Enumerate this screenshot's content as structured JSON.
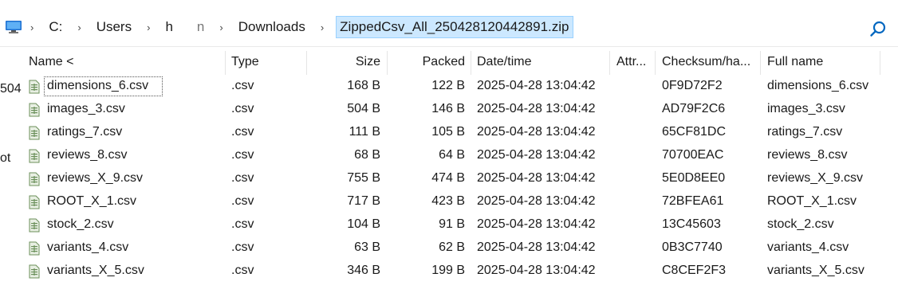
{
  "address_bar": {
    "crumbs": [
      "C:",
      "Users",
      "h",
      "n",
      "Downloads",
      "ZippedCsv_All_250428120442891.zip"
    ],
    "separator": "›"
  },
  "nav_fragments": [
    "504",
    "ot"
  ],
  "columns": [
    "Name <",
    "Type",
    "Size",
    "Packed",
    "Date/time",
    "Attr...",
    "Checksum/ha...",
    "Full name"
  ],
  "rows": [
    {
      "name": "dimensions_6.csv",
      "type": ".csv",
      "size": "168 B",
      "packed": "122 B",
      "date": "2025-04-28 13:04:42",
      "attr": "",
      "checksum": "0F9D72F2",
      "fullname": "dimensions_6.csv"
    },
    {
      "name": "images_3.csv",
      "type": ".csv",
      "size": "504 B",
      "packed": "146 B",
      "date": "2025-04-28 13:04:42",
      "attr": "",
      "checksum": "AD79F2C6",
      "fullname": "images_3.csv"
    },
    {
      "name": "ratings_7.csv",
      "type": ".csv",
      "size": "111 B",
      "packed": "105 B",
      "date": "2025-04-28 13:04:42",
      "attr": "",
      "checksum": "65CF81DC",
      "fullname": "ratings_7.csv"
    },
    {
      "name": "reviews_8.csv",
      "type": ".csv",
      "size": "68 B",
      "packed": "64 B",
      "date": "2025-04-28 13:04:42",
      "attr": "",
      "checksum": "70700EAC",
      "fullname": "reviews_8.csv"
    },
    {
      "name": "reviews_X_9.csv",
      "type": ".csv",
      "size": "755 B",
      "packed": "474 B",
      "date": "2025-04-28 13:04:42",
      "attr": "",
      "checksum": "5E0D8EE0",
      "fullname": "reviews_X_9.csv"
    },
    {
      "name": "ROOT_X_1.csv",
      "type": ".csv",
      "size": "717 B",
      "packed": "423 B",
      "date": "2025-04-28 13:04:42",
      "attr": "",
      "checksum": "72BFEA61",
      "fullname": "ROOT_X_1.csv"
    },
    {
      "name": "stock_2.csv",
      "type": ".csv",
      "size": "104 B",
      "packed": "91 B",
      "date": "2025-04-28 13:04:42",
      "attr": "",
      "checksum": "13C45603",
      "fullname": "stock_2.csv"
    },
    {
      "name": "variants_4.csv",
      "type": ".csv",
      "size": "63 B",
      "packed": "62 B",
      "date": "2025-04-28 13:04:42",
      "attr": "",
      "checksum": "0B3C7740",
      "fullname": "variants_4.csv"
    },
    {
      "name": "variants_X_5.csv",
      "type": ".csv",
      "size": "346 B",
      "packed": "199 B",
      "date": "2025-04-28 13:04:42",
      "attr": "",
      "checksum": "C8CEF2F3",
      "fullname": "variants_X_5.csv"
    }
  ],
  "icons": {
    "computer": "computer-icon",
    "search": "search-icon",
    "file": "csv-file-icon"
  },
  "colors": {
    "selected_crumb_bg": "#cce8ff",
    "selected_crumb_border": "#99d1ff",
    "search_icon": "#0067c0",
    "file_icon": "#6b8f5a"
  }
}
